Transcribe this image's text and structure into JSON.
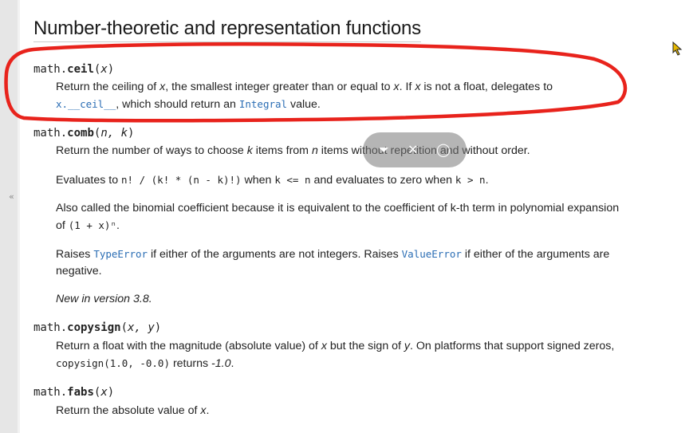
{
  "sidebar": {
    "collapse_label": "«"
  },
  "page": {
    "title": "Number-theoretic and representation functions"
  },
  "entries": {
    "ceil": {
      "module": "math.",
      "name": "ceil",
      "open": "(",
      "params": "x",
      "close": ")",
      "desc_1": "Return the ceiling of ",
      "x1": "x",
      "desc_2": ", the smallest integer greater than or equal to ",
      "x2": "x",
      "desc_3": ". If ",
      "x3": "x",
      "desc_4": " is not a float, delegates to",
      "code_1": "x.__ceil__",
      "desc_5": ", which should return an ",
      "code_2": "Integral",
      "desc_6": " value."
    },
    "comb": {
      "module": "math.",
      "name": "comb",
      "open": "(",
      "params": "n, k",
      "close": ")",
      "p1_a": "Return the number of ways to choose ",
      "p1_k": "k",
      "p1_b": " items from ",
      "p1_n": "n",
      "p1_c": " items without repetition and without order.",
      "p2_a": "Evaluates to ",
      "p2_code1": "n! / (k! * (n - k)!)",
      "p2_b": " when ",
      "p2_code2": "k <= n",
      "p2_c": " and evaluates to zero when ",
      "p2_code3": "k > n",
      "p2_d": ".",
      "p3_a": "Also called the binomial coefficient because it is equivalent to the coefficient of k-th term in polynomial expansion of ",
      "p3_code": "(1 + x)ⁿ",
      "p3_b": ".",
      "p4_a": "Raises ",
      "p4_code1": "TypeError",
      "p4_b": " if either of the arguments are not integers. Raises ",
      "p4_code2": "ValueError",
      "p4_c": " if either of the arguments are negative.",
      "p5": "New in version 3.8."
    },
    "copysign": {
      "module": "math.",
      "name": "copysign",
      "open": "(",
      "params": "x, y",
      "close": ")",
      "d_a": "Return a float with the magnitude (absolute value) of ",
      "d_x": "x",
      "d_b": " but the sign of ",
      "d_y": "y",
      "d_c": ". On platforms that support signed zeros, ",
      "d_code": "copysign(1.0, -0.0)",
      "d_d": " returns ",
      "d_e": "-1.0",
      "d_f": "."
    },
    "fabs": {
      "module": "math.",
      "name": "fabs",
      "open": "(",
      "params": "x",
      "close": ")",
      "d_a": "Return the absolute value of ",
      "d_x": "x",
      "d_b": "."
    }
  },
  "colors": {
    "annotation": "#e8231c",
    "link": "#2a6db4"
  },
  "icons": {
    "cursor": "arrow-cursor-icon",
    "overlay": "media-controls-icon"
  }
}
